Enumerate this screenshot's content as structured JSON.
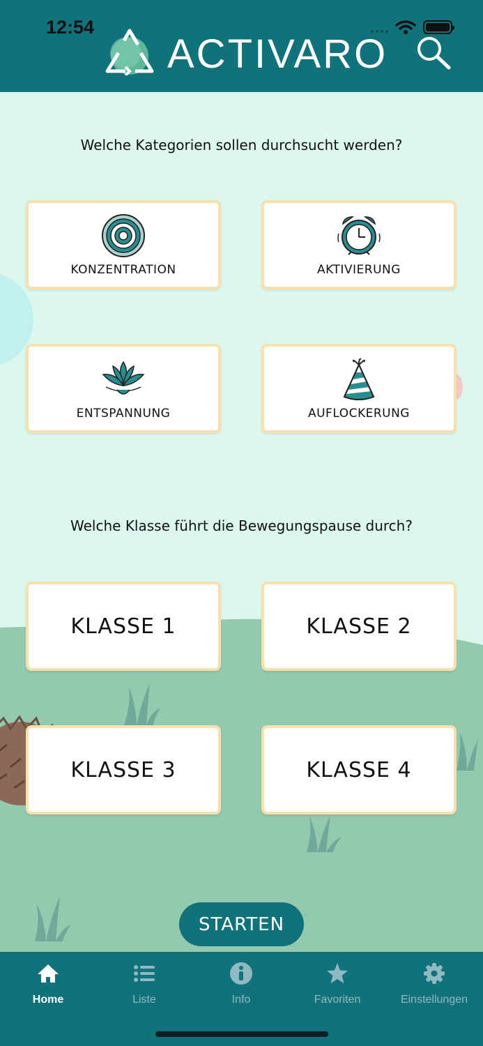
{
  "status_bar": {
    "time": "12:54"
  },
  "header": {
    "app_name": "ACTIVARO"
  },
  "categories": {
    "question": "Welche Kategorien sollen durchsucht werden?",
    "items": [
      {
        "label": "KONZENTRATION",
        "icon": "target-icon"
      },
      {
        "label": "AKTIVIERUNG",
        "icon": "alarm-clock-icon"
      },
      {
        "label": "ENTSPANNUNG",
        "icon": "lotus-icon"
      },
      {
        "label": "AUFLOCKERUNG",
        "icon": "party-hat-icon"
      }
    ]
  },
  "classes": {
    "question": "Welche Klasse führt die Bewegungspause durch?",
    "items": [
      {
        "label": "KLASSE 1"
      },
      {
        "label": "KLASSE 2"
      },
      {
        "label": "KLASSE 3"
      },
      {
        "label": "KLASSE 4"
      }
    ]
  },
  "start_button": {
    "label": "STARTEN"
  },
  "tabbar": {
    "active": "Home",
    "items": [
      {
        "label": "Home",
        "icon": "home-icon"
      },
      {
        "label": "Liste",
        "icon": "list-icon"
      },
      {
        "label": "Info",
        "icon": "info-icon"
      },
      {
        "label": "Favoriten",
        "icon": "star-icon"
      },
      {
        "label": "Einstellungen",
        "icon": "gear-icon"
      }
    ]
  },
  "colors": {
    "primary": "#12727b",
    "background": "#dcf7ec",
    "hill": "#93c9ae",
    "card_border": "#f9dfae",
    "tab_inactive": "#8fbac0"
  }
}
